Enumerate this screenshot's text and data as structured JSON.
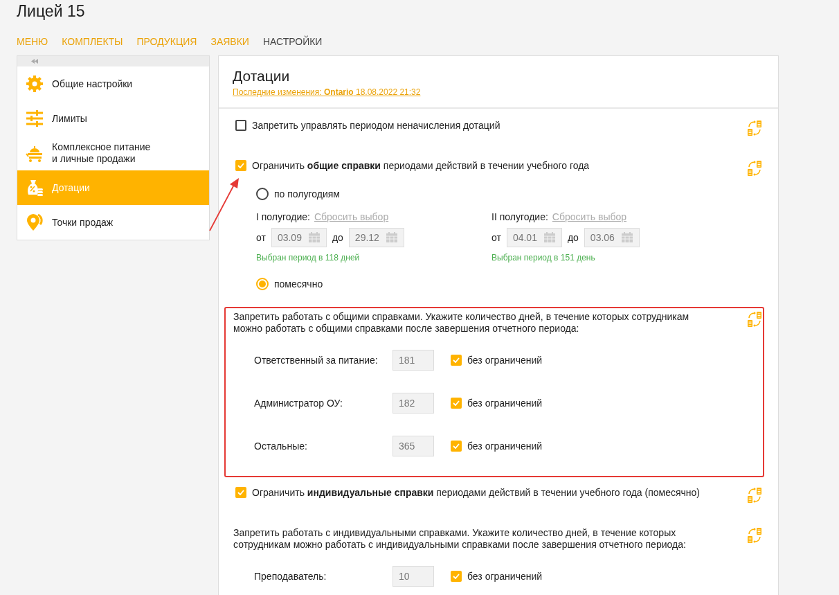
{
  "title": "Лицей 15",
  "nav": [
    {
      "label": "МЕНЮ",
      "selected": false
    },
    {
      "label": "КОМПЛЕКТЫ",
      "selected": false
    },
    {
      "label": "ПРОДУКЦИЯ",
      "selected": false
    },
    {
      "label": "ЗАЯВКИ",
      "selected": false
    },
    {
      "label": "НАСТРОЙКИ",
      "selected": true
    }
  ],
  "sidebar": {
    "items": [
      {
        "label": "Общие настройки",
        "selected": false
      },
      {
        "label": "Лимиты",
        "selected": false
      },
      {
        "label": "Комплексное питание\nи личные продажи",
        "selected": false
      },
      {
        "label": "Дотации",
        "selected": true
      },
      {
        "label": "Точки продаж",
        "selected": false
      }
    ]
  },
  "panel": {
    "title": "Дотации",
    "last_change": "Последние изменения: **Ontario** 18.08.2022 21:32"
  },
  "sections": [
    {
      "kind": "checkbox",
      "checked": false,
      "label": "Запретить управлять периодом неначисления дотаций"
    },
    {
      "kind": "checkbox",
      "checked": true,
      "label": "Ограничить **общие справки** периодами действий в течении учебного года",
      "options": [
        {
          "label": "по полугодиям",
          "selected": false,
          "halves": [
            {
              "label": "I полугодие:",
              "reset": "Сбросить выбор",
              "from_label": "от",
              "from": "03.09",
              "to_label": "до",
              "to": "29.12",
              "note": "Выбран период в 118 дней"
            },
            {
              "label": "II полугодие:",
              "reset": "Сбросить выбор",
              "from_label": "от",
              "from": "04.01",
              "to_label": "до",
              "to": "03.06",
              "note": "Выбран период в 151 день"
            }
          ]
        },
        {
          "label": "помесячно",
          "selected": true
        }
      ]
    },
    {
      "kind": "limits",
      "highlighted": true,
      "text": "Запретить работать с общими справками. Укажите количество дней, в течение которых сотрудникам можно работать с общими справками после завершения отчетного периода:",
      "rows": [
        {
          "label": "Ответственный за питание:",
          "value": "181",
          "unlimited": "без ограничений",
          "checked": true
        },
        {
          "label": "Администратор ОУ:",
          "value": "182",
          "unlimited": "без ограничений",
          "checked": true
        },
        {
          "label": "Остальные:",
          "value": "365",
          "unlimited": "без ограничений",
          "checked": true
        }
      ]
    },
    {
      "kind": "checkbox",
      "checked": true,
      "label": "Ограничить **индивидуальные справки** периодами действий в течении учебного года (помесячно)"
    },
    {
      "kind": "limits",
      "highlighted": false,
      "text": "Запретить работать с индивидуальными справками. Укажите количество дней, в течение которых сотрудникам можно работать с индивидуальными справками после завершения отчетного периода:",
      "rows": [
        {
          "label": "Преподаватель:",
          "value": "10",
          "unlimited": "без ограничений",
          "checked": true
        }
      ]
    }
  ]
}
